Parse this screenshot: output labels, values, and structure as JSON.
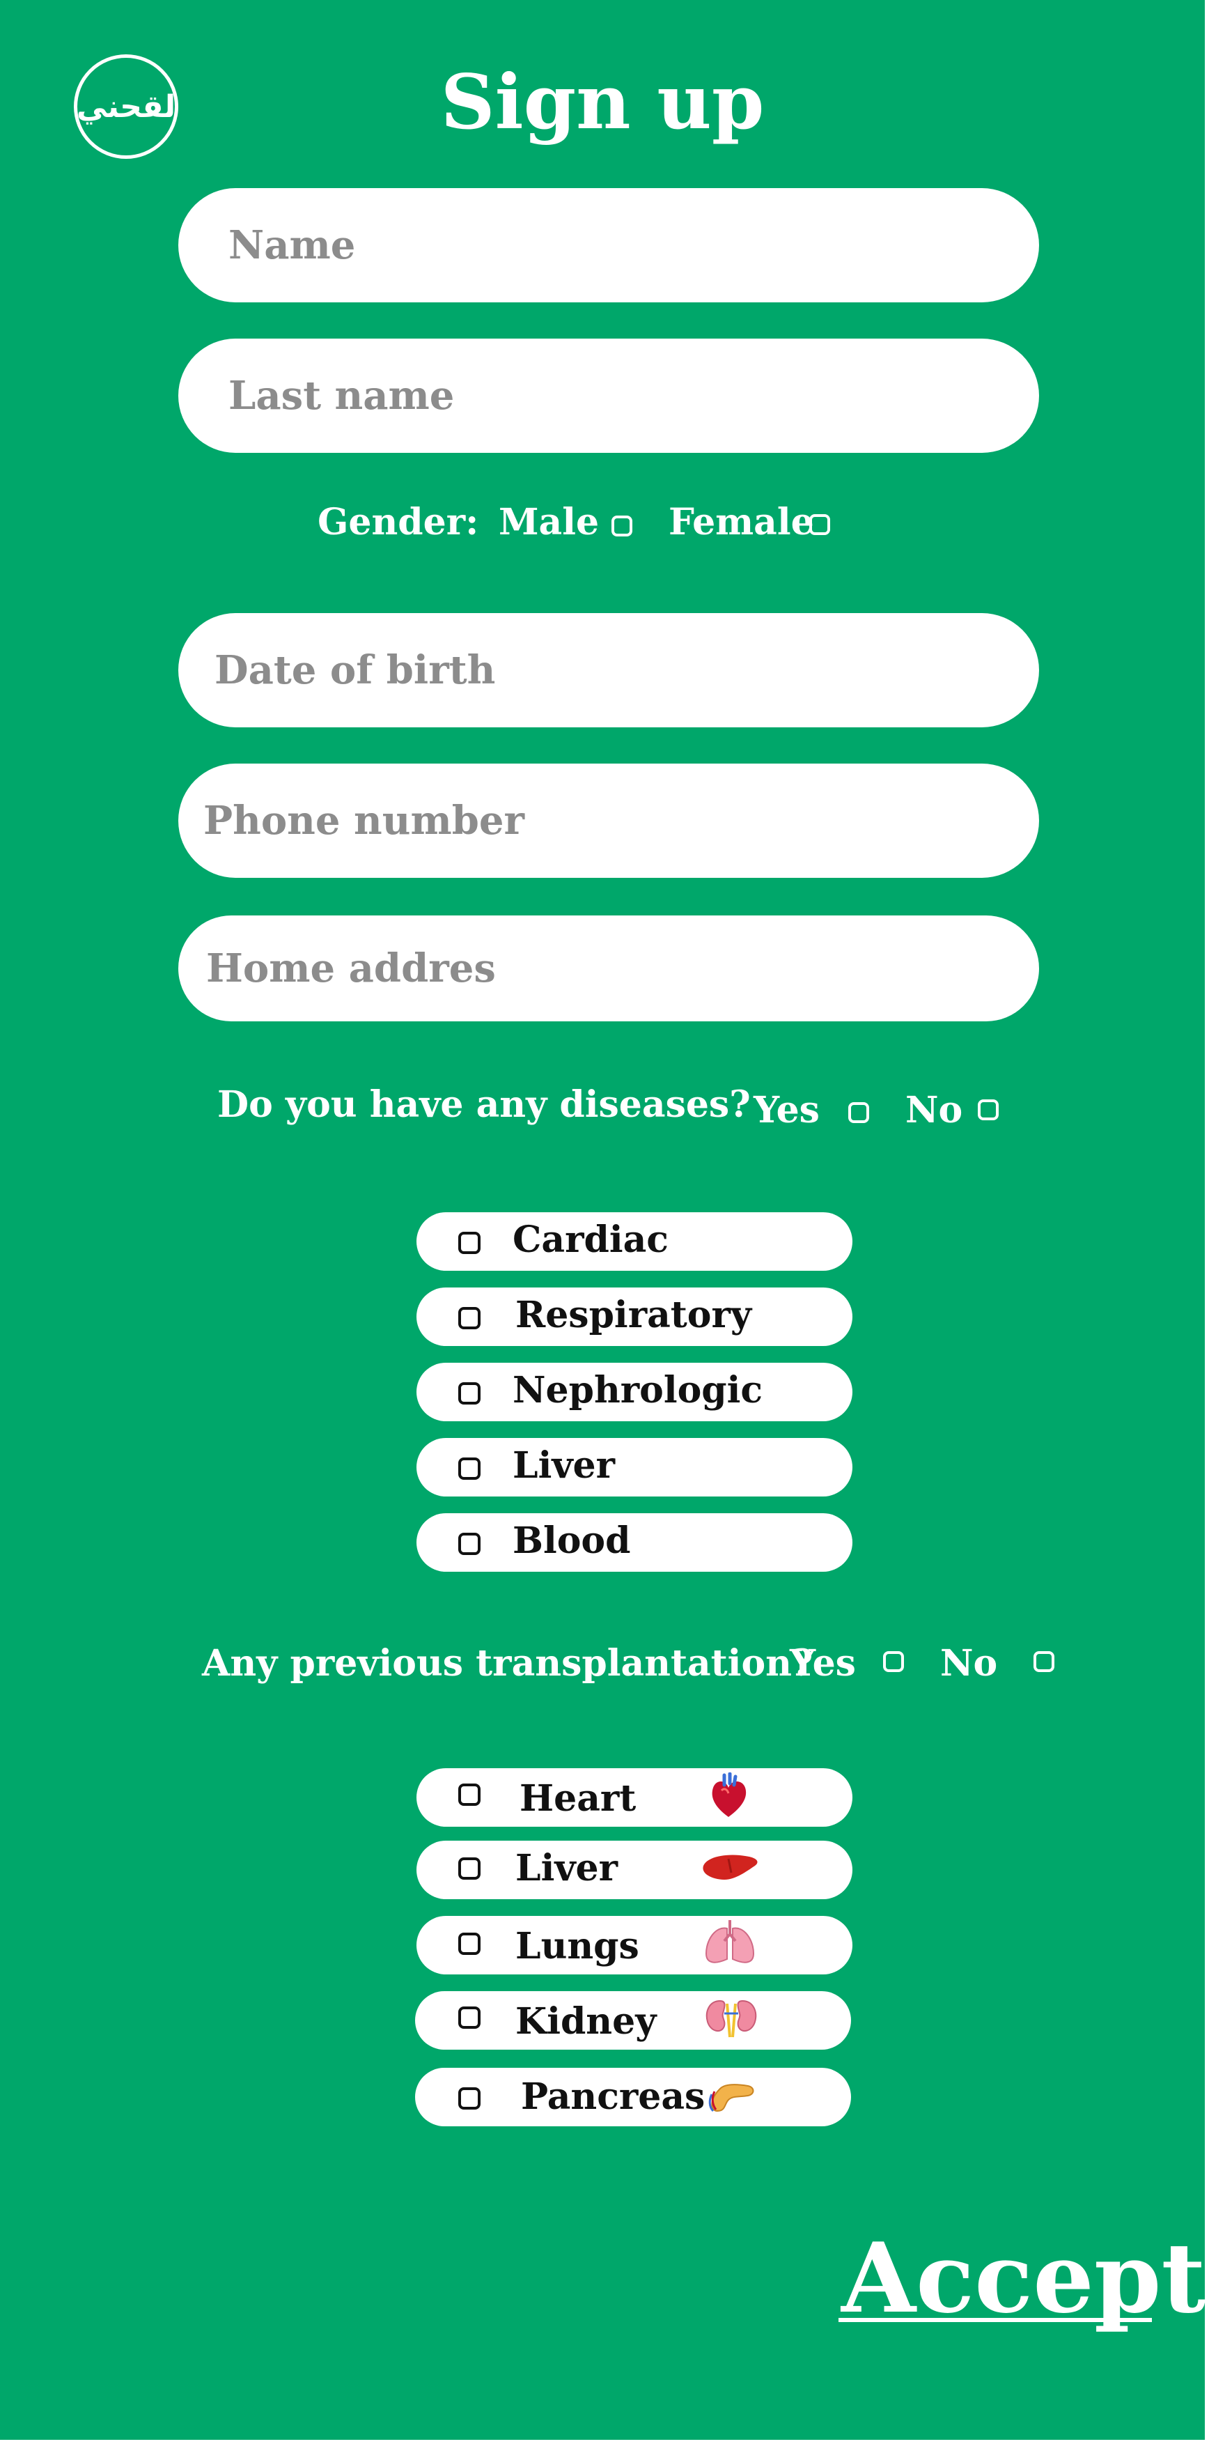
{
  "app": {
    "logo_text": "لقحني",
    "title": "Sign up"
  },
  "form": {
    "name_placeholder": "Name",
    "last_name_placeholder": "Last name",
    "gender_label": "Gender:",
    "male_label": "Male",
    "female_label": "Female",
    "dob_placeholder": "Date of birth",
    "phone_placeholder": "Phone number",
    "address_placeholder": "Home addres"
  },
  "diseases": {
    "question": "Do you have any diseases?",
    "yes_label": "Yes",
    "no_label": "No",
    "options": [
      "Cardiac",
      "Respiratory",
      "Nephrologic",
      "Liver",
      "Blood"
    ]
  },
  "transplant": {
    "question": "Any previous transplantation?",
    "yes_label": "Yes",
    "no_label": "No",
    "options": [
      {
        "label": "Heart",
        "icon": "heart-organ-icon"
      },
      {
        "label": "Liver",
        "icon": "liver-organ-icon"
      },
      {
        "label": "Lungs",
        "icon": "lungs-organ-icon"
      },
      {
        "label": "Kidney",
        "icon": "kidney-organ-icon"
      },
      {
        "label": "Pancreas",
        "icon": "pancreas-organ-icon"
      }
    ]
  },
  "actions": {
    "accept_label": "Accept"
  },
  "colors": {
    "background": "#00a76a",
    "field": "#ffffff",
    "placeholder": "#8c8c8c"
  }
}
